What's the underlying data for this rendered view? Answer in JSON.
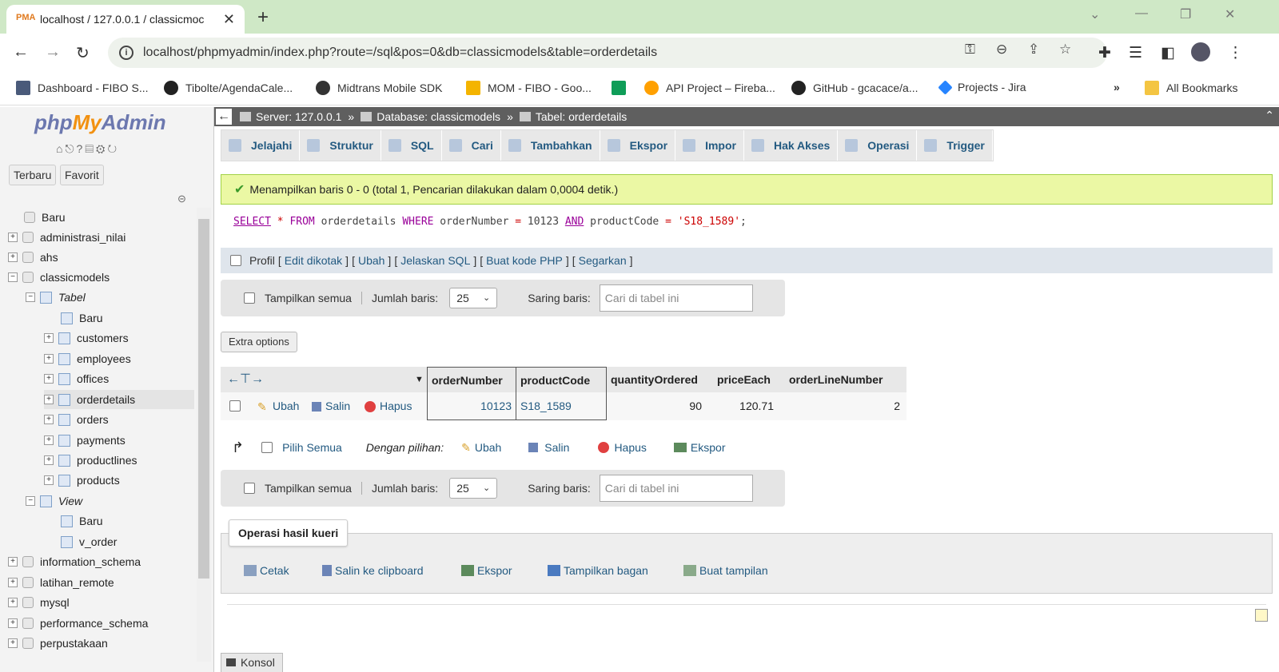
{
  "browser": {
    "tab_title": "localhost / 127.0.0.1 / classicmoc",
    "favicon_text": "PMA",
    "url": "localhost/phpmyadmin/index.php?route=/sql&pos=0&db=classicmodels&table=orderdetails",
    "bookmarks": [
      {
        "label": "Dashboard - FIBO S..."
      },
      {
        "label": "Tibolte/AgendaCale..."
      },
      {
        "label": "Midtrans Mobile SDK"
      },
      {
        "label": "MOM - FIBO - Goo..."
      },
      {
        "label": ""
      },
      {
        "label": "API Project – Fireba..."
      },
      {
        "label": "GitHub - gcacace/a..."
      },
      {
        "label": "Projects - Jira"
      }
    ],
    "all_bookmarks": "All Bookmarks",
    "more": "»"
  },
  "sidebar": {
    "logo_php": "php",
    "logo_my": "My",
    "logo_admin": "Admin",
    "recent": "Terbaru",
    "favorite": "Favorit",
    "tree": [
      {
        "label": "Baru"
      },
      {
        "label": "administrasi_nilai"
      },
      {
        "label": "ahs"
      },
      {
        "label": "classicmodels"
      },
      {
        "label": "Tabel"
      },
      {
        "label": "Baru"
      },
      {
        "label": "customers"
      },
      {
        "label": "employees"
      },
      {
        "label": "offices"
      },
      {
        "label": "orderdetails"
      },
      {
        "label": "orders"
      },
      {
        "label": "payments"
      },
      {
        "label": "productlines"
      },
      {
        "label": "products"
      },
      {
        "label": "View"
      },
      {
        "label": "Baru"
      },
      {
        "label": "v_order"
      },
      {
        "label": "information_schema"
      },
      {
        "label": "latihan_remote"
      },
      {
        "label": "mysql"
      },
      {
        "label": "performance_schema"
      },
      {
        "label": "perpustakaan"
      }
    ]
  },
  "breadcrumb": {
    "server": "Server: 127.0.0.1",
    "database": "Database: classicmodels",
    "table": "Tabel: orderdetails",
    "sep": "»"
  },
  "tabs": [
    "Jelajahi",
    "Struktur",
    "SQL",
    "Cari",
    "Tambahkan",
    "Ekspor",
    "Impor",
    "Hak Akses",
    "Operasi",
    "Trigger"
  ],
  "message": "Menampilkan baris 0 - 0 (total 1, Pencarian dilakukan dalam 0,0004 detik.)",
  "sql": {
    "select": "SELECT",
    "star": " * ",
    "from": "FROM",
    "table": " orderdetails ",
    "where": "WHERE",
    "col1": " orderNumber ",
    "eq1": "=",
    "val1": " 10123 ",
    "and": "AND",
    "col2": " productCode ",
    "eq2": "=",
    "val2": " 'S18_1589'",
    "end": ";"
  },
  "sql_links": {
    "profil": "Profil",
    "edit_inline": "Edit dikotak",
    "edit": "Ubah",
    "explain": "Jelaskan SQL",
    "php_code": "Buat kode PHP",
    "refresh": "Segarkan",
    "open": "[",
    "close": "]"
  },
  "nav": {
    "show_all": "Tampilkan semua",
    "rows_label": "Jumlah baris:",
    "rows_value": "25",
    "filter_label": "Saring baris:",
    "filter_placeholder": "Cari di tabel ini"
  },
  "extra_options": "Extra options",
  "results": {
    "columns": [
      "orderNumber",
      "productCode",
      "quantityOrdered",
      "priceEach",
      "orderLineNumber"
    ],
    "rows": [
      {
        "orderNumber": "10123",
        "productCode": "S18_1589",
        "quantityOrdered": "90",
        "priceEach": "120.71",
        "orderLineNumber": "2"
      }
    ],
    "row_actions": {
      "edit": "Ubah",
      "copy": "Salin",
      "delete": "Hapus"
    }
  },
  "bulk": {
    "select_all": "Pilih Semua",
    "with_selected": "Dengan pilihan:",
    "edit": "Ubah",
    "copy": "Salin",
    "delete": "Hapus",
    "export": "Ekspor"
  },
  "query_ops": {
    "title": "Operasi hasil kueri",
    "print": "Cetak",
    "copy_clipboard": "Salin ke clipboard",
    "export": "Ekspor",
    "chart": "Tampilkan bagan",
    "create_view": "Buat tampilan"
  },
  "console": "Konsol",
  "colors": {
    "link": "#235a81",
    "success_bg": "#ebf8a4",
    "topbar": "#5f5f5f"
  }
}
